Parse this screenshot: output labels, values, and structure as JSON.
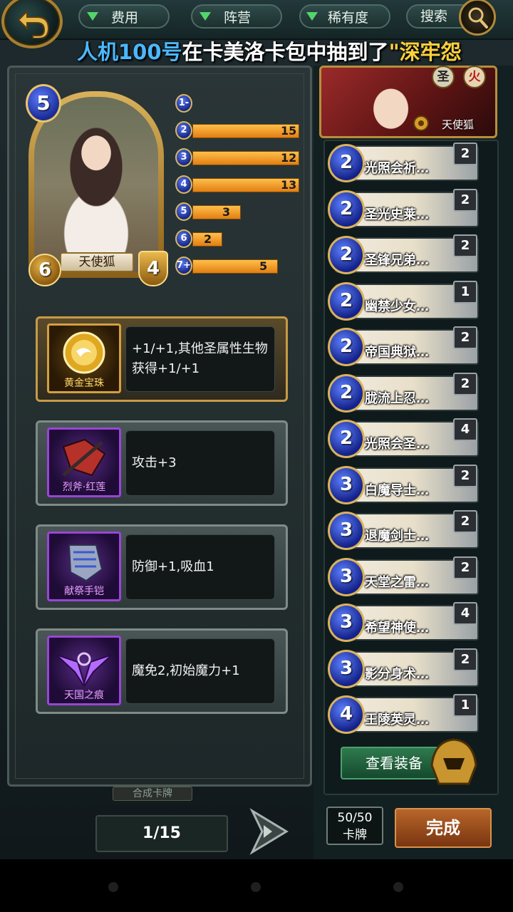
{
  "topbar": {
    "filters": [
      {
        "label": "费用"
      },
      {
        "label": "阵营"
      },
      {
        "label": "稀有度"
      }
    ],
    "search_label": "搜索"
  },
  "marquee": {
    "who": "人机100号",
    "what": "在卡美洛卡包中抽到了",
    "card": "\"深牢怨"
  },
  "hero": {
    "name": "天使狐",
    "cost": "5",
    "attack": "6",
    "defense": "4"
  },
  "cost_curve": [
    {
      "cost": "1-",
      "count": "",
      "fraction": 0
    },
    {
      "cost": "2",
      "count": "15",
      "fraction": 1.0
    },
    {
      "cost": "3",
      "count": "12",
      "fraction": 1.0
    },
    {
      "cost": "4",
      "count": "13",
      "fraction": 1.0
    },
    {
      "cost": "5",
      "count": "3",
      "fraction": 0.45
    },
    {
      "cost": "6",
      "count": "2",
      "fraction": 0.28
    },
    {
      "cost": "7+",
      "count": "5",
      "fraction": 0.8
    }
  ],
  "equipment": [
    {
      "name": "黄金宝珠",
      "desc": "+1/+1,其他圣属性生物获得+1/+1",
      "rarity": "gold"
    },
    {
      "name": "烈斧·红莲",
      "desc": "攻击+3",
      "rarity": "purple"
    },
    {
      "name": "献祭手铠",
      "desc": "防御+1,吸血1",
      "rarity": "purple"
    },
    {
      "name": "天国之痕",
      "desc": "魔免2,初始魔力+1",
      "rarity": "purple"
    }
  ],
  "synth_label": "合成卡牌",
  "page_indicator": "1/15",
  "deck_hero": {
    "name": "天使狐",
    "elements": [
      "圣",
      "火"
    ]
  },
  "deck_cards": [
    {
      "cost": "2",
      "name": "光照会祈…",
      "count": "2"
    },
    {
      "cost": "2",
      "name": "圣光史莱…",
      "count": "2"
    },
    {
      "cost": "2",
      "name": "圣锋兄弟…",
      "count": "2"
    },
    {
      "cost": "2",
      "name": "幽禁少女…",
      "count": "1"
    },
    {
      "cost": "2",
      "name": "帝国典狱…",
      "count": "2"
    },
    {
      "cost": "2",
      "name": "胧流上忍…",
      "count": "2"
    },
    {
      "cost": "2",
      "name": "光照会圣…",
      "count": "4"
    },
    {
      "cost": "3",
      "name": "白魔导士…",
      "count": "2"
    },
    {
      "cost": "3",
      "name": "退魔剑士…",
      "count": "2"
    },
    {
      "cost": "3",
      "name": "天堂之雷…",
      "count": "2"
    },
    {
      "cost": "3",
      "name": "希望神使…",
      "count": "4"
    },
    {
      "cost": "3",
      "name": "影分身术…",
      "count": "2"
    },
    {
      "cost": "4",
      "name": "王陵英灵…",
      "count": "1"
    }
  ],
  "view_equipment_label": "查看装备",
  "deck_size": {
    "value": "50/50",
    "unit": "卡牌"
  },
  "done_label": "完成",
  "colors": {
    "accent_gold": "#c79b45",
    "cost_blue": "#1a2b96",
    "bar_orange": "#e27e12",
    "filter_green": "#52d56a",
    "done_brown": "#7a3510"
  }
}
